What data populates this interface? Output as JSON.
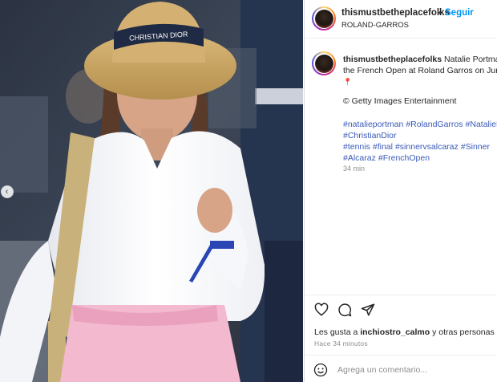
{
  "header": {
    "username": "thismustbetheplacefolks",
    "separator": "•",
    "follow_label": "Seguir",
    "location": "ROLAND-GARROS"
  },
  "caption": {
    "username": "thismustbetheplacefolks",
    "line1": " Natalie Portman at",
    "line2": "the French Open at Roland Garros on June",
    "pin": "📍",
    "credit": "© Getty Images Entertainment",
    "hashtags_line1": [
      "#natalieportman",
      "#RolandGarros",
      "#NataliePortman"
    ],
    "hashtags_line2": [
      "#ChristianDior"
    ],
    "hashtags_line3": [
      "#tennis",
      "#final",
      "#sinnervsalcaraz",
      "#Sinner"
    ],
    "hashtags_line4": [
      "#Alcaraz",
      "#FrenchOpen"
    ],
    "time": "34 min"
  },
  "actions": {
    "icons": [
      "heart-icon",
      "comment-icon",
      "share-icon"
    ],
    "likes_prefix": "Les gusta a ",
    "likes_user": "inchiostro_calmo",
    "likes_suffix": " y otras personas",
    "posted_ago": "Hace 34 minutos",
    "comment_placeholder": "Agrega un comentario..."
  },
  "photo": {
    "hat_band_text": "CHRISTIAN DIOR",
    "carousel_prev": "‹"
  },
  "colors": {
    "accent_blue": "#0095f6",
    "hashtag_blue": "#3a5ab8",
    "muted_gray": "#8e8e8e"
  }
}
